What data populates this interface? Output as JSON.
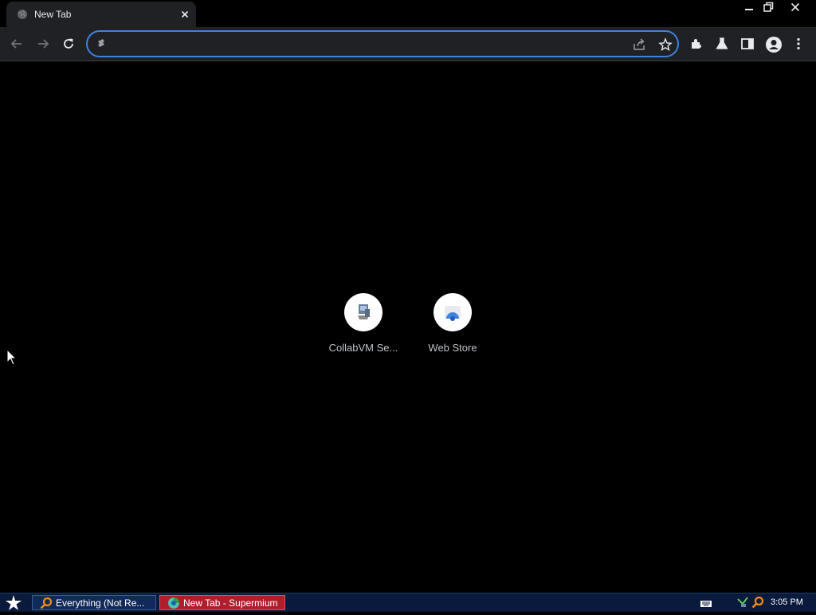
{
  "browser": {
    "tab": {
      "title": "New Tab"
    },
    "omnibox": {
      "value": "",
      "placeholder": ""
    }
  },
  "shortcuts": [
    {
      "label": "CollabVM Se...",
      "icon": "collabvm-icon"
    },
    {
      "label": "Web Store",
      "icon": "web-store-icon"
    }
  ],
  "taskbar": {
    "tasks": [
      {
        "label": "Everything (Not Re...",
        "icon": "magnifier-icon"
      },
      {
        "label": "New Tab - Supermium",
        "icon": "supermium-icon"
      }
    ],
    "clock": "3:05 PM"
  },
  "colors": {
    "accent": "#3d83e0",
    "toolbar": "#202124",
    "page_background": "#000000",
    "taskbar": "#0a1a3c",
    "active_task": "#b01e2e"
  }
}
